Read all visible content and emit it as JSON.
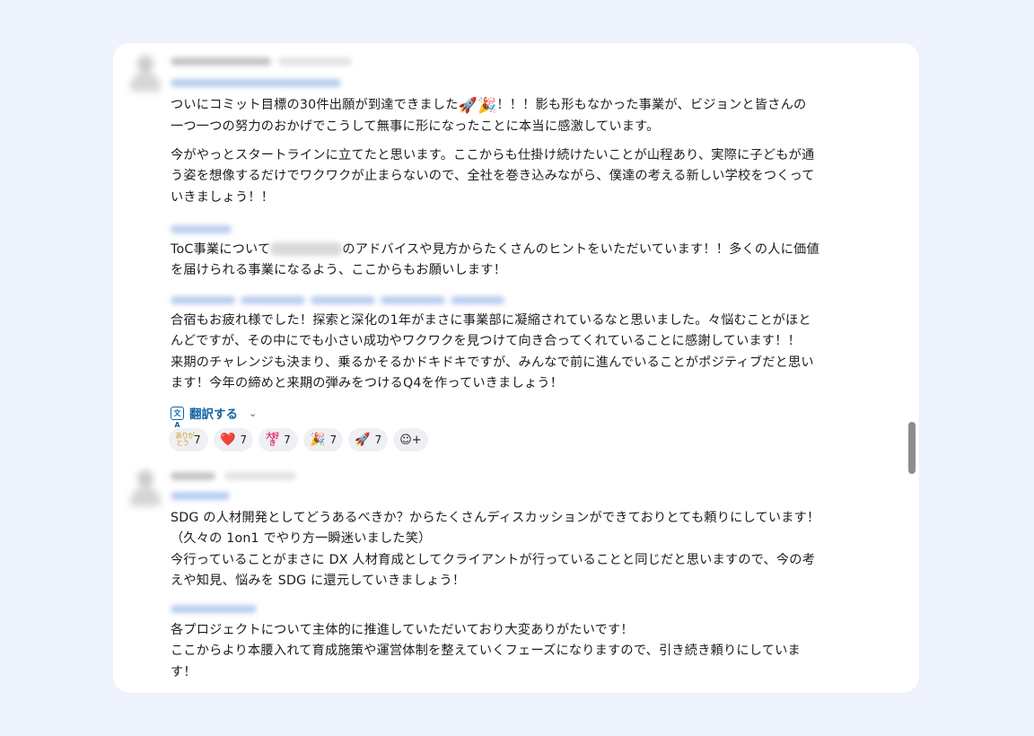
{
  "messages": [
    {
      "paragraphs": {
        "p1_before": "ついにコミット目標の30件出願が到達できました",
        "p1_emoji": "🚀🎉",
        "p1_after": "！！！影も形もなかった事業が、ビジョンと皆さんの\n一つ一つの努力のおかげでこうして無事に形になったことに本当に感激しています。",
        "p2": "今がやっとスタートラインに立てたと思います。ここからも仕掛け続けたいことが山程あり、実際に子どもが通\nう姿を想像するだけでワクワクが止まらないので、全社を巻き込みながら、僕達の考える新しい学校をつくって\nいきましょう！！",
        "p3_before": "ToC事業について",
        "p3_after": "のアドバイスや見方からたくさんのヒントをいただいています！！多くの人に価値\nを届けられる事業になるよう、ここからもお願いします！",
        "p4": "合宿もお疲れ様でした！探索と深化の1年がまさに事業部に凝縮されているなと思いました。々悩むことがほと\nんどですが、その中にでも小さい成功やワクワクを見つけて向き合ってくれていることに感謝しています！！\n来期のチャレンジも決まり、乗るかそるかドキドキですが、みんなで前に進んでいることがポジティブだと思い\nます！今年の締めと来期の弾みをつけるQ4を作っていきましょう！"
      },
      "translate_label": "翻訳する",
      "reactions": [
        {
          "icon": "thanks-text-icon",
          "glyph": "ありが\nとう",
          "count": "7"
        },
        {
          "icon": "heart-icon",
          "glyph": "❤️",
          "count": "7"
        },
        {
          "icon": "love-text-icon",
          "glyph": "大好\nき",
          "count": "7"
        },
        {
          "icon": "party-popper-icon",
          "glyph": "🎉",
          "count": "7"
        },
        {
          "icon": "rocket-icon",
          "glyph": "🚀",
          "count": "7"
        }
      ],
      "add_reaction_glyph": "☺+"
    },
    {
      "paragraphs": {
        "p1": "SDG の人材開発としてどうあるべきか？からたくさんディスカッションができておりとても頼りにしています！\n（久々の 1on1 でやり方一瞬迷いました笑）\n今行っていることがまさに DX 人材育成としてクライアントが行っていることと同じだと思いますので、今の考\nえや知見、悩みを SDG に還元していきましょう！",
        "p2": "各プロジェクトについて主体的に推進していただいており大変ありがたいです！\nここからより本腰入れて育成施策や運営体制を整えていくフェーズになりますので、引き続き頼りにしていま\nす！"
      }
    }
  ],
  "colors": {
    "background": "#eef3fd",
    "card": "#ffffff",
    "link": "#1264a3",
    "reaction_bg": "#eef0f3"
  }
}
